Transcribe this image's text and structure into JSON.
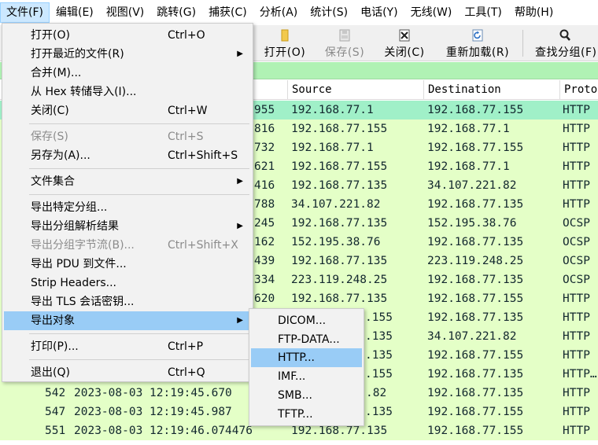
{
  "menubar": {
    "items": [
      {
        "label": "文件(F)"
      },
      {
        "label": "编辑(E)"
      },
      {
        "label": "视图(V)"
      },
      {
        "label": "跳转(G)"
      },
      {
        "label": "捕获(C)"
      },
      {
        "label": "分析(A)"
      },
      {
        "label": "统计(S)"
      },
      {
        "label": "电话(Y)"
      },
      {
        "label": "无线(W)"
      },
      {
        "label": "工具(T)"
      },
      {
        "label": "帮助(H)"
      }
    ]
  },
  "toolbar": {
    "open_label": "打开(O)",
    "save_label": "保存(S)",
    "close_label": "关闭(C)",
    "reload_label": "重新加载(R)",
    "find_label": "查找分组(F)"
  },
  "packet_list": {
    "columns": [
      "Source",
      "Destination",
      "Protocol"
    ],
    "rows": [
      {
        "time_tail": "955",
        "source": "192.168.77.1",
        "destination": "192.168.77.155",
        "protocol": "HTTP"
      },
      {
        "time_tail": "816",
        "source": "192.168.77.155",
        "destination": "192.168.77.1",
        "protocol": "HTTP"
      },
      {
        "time_tail": "732",
        "source": "192.168.77.1",
        "destination": "192.168.77.155",
        "protocol": "HTTP"
      },
      {
        "time_tail": "621",
        "source": "192.168.77.155",
        "destination": "192.168.77.1",
        "protocol": "HTTP"
      },
      {
        "time_tail": "416",
        "source": "192.168.77.135",
        "destination": "34.107.221.82",
        "protocol": "HTTP"
      },
      {
        "time_tail": "788",
        "source": "34.107.221.82",
        "destination": "192.168.77.135",
        "protocol": "HTTP"
      },
      {
        "time_tail": "245",
        "source": "192.168.77.135",
        "destination": "152.195.38.76",
        "protocol": "OCSP"
      },
      {
        "time_tail": "162",
        "source": "152.195.38.76",
        "destination": "192.168.77.135",
        "protocol": "OCSP"
      },
      {
        "time_tail": "439",
        "source": "192.168.77.135",
        "destination": "223.119.248.25",
        "protocol": "OCSP"
      },
      {
        "time_tail": "334",
        "source": "223.119.248.25",
        "destination": "192.168.77.135",
        "protocol": "OCSP"
      },
      {
        "time_tail": "620",
        "source": "192.168.77.135",
        "destination": "192.168.77.155",
        "protocol": "HTTP"
      },
      {
        "time_tail": "",
        "source": ".155",
        "destination": "192.168.77.135",
        "protocol": "HTTP"
      },
      {
        "time_tail": "",
        "source": ".135",
        "destination": "34.107.221.82",
        "protocol": "HTTP"
      },
      {
        "time_tail": "",
        "source": ".135",
        "destination": "192.168.77.155",
        "protocol": "HTTP"
      },
      {
        "time_tail": "",
        "source": ".155",
        "destination": "192.168.77.135",
        "protocol": "HTTP…"
      },
      {
        "no": "542",
        "time": "2023-08-03 12:19:45.670",
        "source": ".82",
        "destination": "192.168.77.135",
        "protocol": "HTTP"
      },
      {
        "no": "547",
        "time": "2023-08-03 12:19:45.987",
        "source": ".135",
        "destination": "192.168.77.155",
        "protocol": "HTTP"
      },
      {
        "no": "551",
        "time": "2023-08-03 12:19:46.074476",
        "source": "192.168.77.135",
        "destination": "192.168.77.155",
        "protocol": "HTTP"
      }
    ]
  },
  "file_menu": {
    "items": [
      {
        "label": "打开(O)",
        "shortcut": "Ctrl+O"
      },
      {
        "label": "打开最近的文件(R)",
        "shortcut": ""
      },
      {
        "label": "合并(M)...",
        "shortcut": ""
      },
      {
        "label": "从 Hex 转储导入(I)...",
        "shortcut": ""
      },
      {
        "label": "关闭(C)",
        "shortcut": "Ctrl+W"
      },
      {
        "label": "保存(S)",
        "shortcut": "Ctrl+S"
      },
      {
        "label": "另存为(A)...",
        "shortcut": "Ctrl+Shift+S"
      },
      {
        "label": "文件集合",
        "shortcut": ""
      },
      {
        "label": "导出特定分组...",
        "shortcut": ""
      },
      {
        "label": "导出分组解析结果",
        "shortcut": ""
      },
      {
        "label": "导出分组字节流(B)...",
        "shortcut": "Ctrl+Shift+X"
      },
      {
        "label": "导出 PDU 到文件...",
        "shortcut": ""
      },
      {
        "label": "Strip Headers...",
        "shortcut": ""
      },
      {
        "label": "导出 TLS 会话密钥...",
        "shortcut": ""
      },
      {
        "label": "导出对象",
        "shortcut": ""
      },
      {
        "label": "打印(P)...",
        "shortcut": "Ctrl+P"
      },
      {
        "label": "退出(Q)",
        "shortcut": "Ctrl+Q"
      }
    ],
    "submenu_arrow": "▶"
  },
  "export_objects_submenu": {
    "items": [
      {
        "label": "DICOM..."
      },
      {
        "label": "FTP-DATA..."
      },
      {
        "label": "HTTP..."
      },
      {
        "label": "IMF..."
      },
      {
        "label": "SMB..."
      },
      {
        "label": "TFTP..."
      }
    ]
  },
  "colors": {
    "highlight": "#99ccf6",
    "row_bg": "#e4ffc7",
    "selected_row_bg": "#a0f0c8",
    "filter_bar": "#b0f2b4"
  },
  "icons": [
    "folder-open-icon",
    "save-file-icon",
    "close-file-icon",
    "reload-icon",
    "find-packet-icon"
  ]
}
